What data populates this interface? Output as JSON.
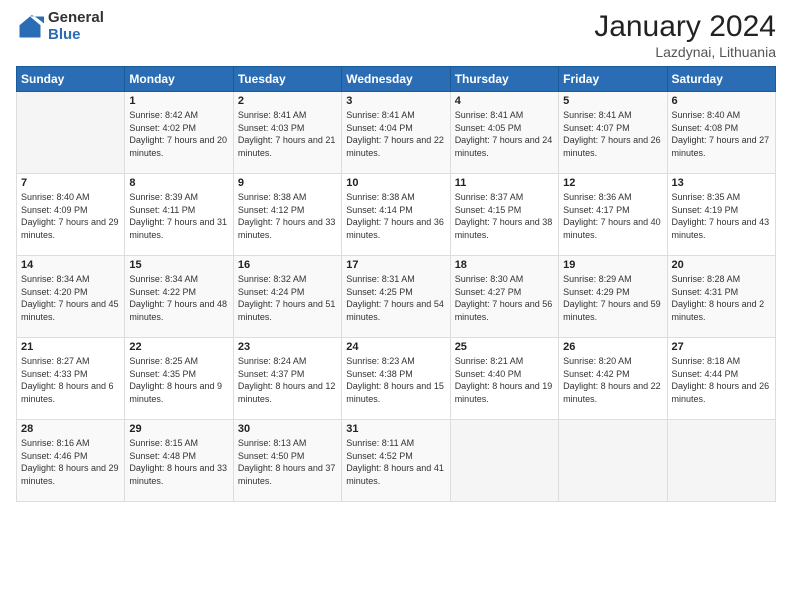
{
  "header": {
    "logo_general": "General",
    "logo_blue": "Blue",
    "title": "January 2024",
    "subtitle": "Lazdynai, Lithuania"
  },
  "days_of_week": [
    "Sunday",
    "Monday",
    "Tuesday",
    "Wednesday",
    "Thursday",
    "Friday",
    "Saturday"
  ],
  "weeks": [
    [
      {
        "day": "",
        "sunrise": "",
        "sunset": "",
        "daylight": ""
      },
      {
        "day": "1",
        "sunrise": "Sunrise: 8:42 AM",
        "sunset": "Sunset: 4:02 PM",
        "daylight": "Daylight: 7 hours and 20 minutes."
      },
      {
        "day": "2",
        "sunrise": "Sunrise: 8:41 AM",
        "sunset": "Sunset: 4:03 PM",
        "daylight": "Daylight: 7 hours and 21 minutes."
      },
      {
        "day": "3",
        "sunrise": "Sunrise: 8:41 AM",
        "sunset": "Sunset: 4:04 PM",
        "daylight": "Daylight: 7 hours and 22 minutes."
      },
      {
        "day": "4",
        "sunrise": "Sunrise: 8:41 AM",
        "sunset": "Sunset: 4:05 PM",
        "daylight": "Daylight: 7 hours and 24 minutes."
      },
      {
        "day": "5",
        "sunrise": "Sunrise: 8:41 AM",
        "sunset": "Sunset: 4:07 PM",
        "daylight": "Daylight: 7 hours and 26 minutes."
      },
      {
        "day": "6",
        "sunrise": "Sunrise: 8:40 AM",
        "sunset": "Sunset: 4:08 PM",
        "daylight": "Daylight: 7 hours and 27 minutes."
      }
    ],
    [
      {
        "day": "7",
        "sunrise": "Sunrise: 8:40 AM",
        "sunset": "Sunset: 4:09 PM",
        "daylight": "Daylight: 7 hours and 29 minutes."
      },
      {
        "day": "8",
        "sunrise": "Sunrise: 8:39 AM",
        "sunset": "Sunset: 4:11 PM",
        "daylight": "Daylight: 7 hours and 31 minutes."
      },
      {
        "day": "9",
        "sunrise": "Sunrise: 8:38 AM",
        "sunset": "Sunset: 4:12 PM",
        "daylight": "Daylight: 7 hours and 33 minutes."
      },
      {
        "day": "10",
        "sunrise": "Sunrise: 8:38 AM",
        "sunset": "Sunset: 4:14 PM",
        "daylight": "Daylight: 7 hours and 36 minutes."
      },
      {
        "day": "11",
        "sunrise": "Sunrise: 8:37 AM",
        "sunset": "Sunset: 4:15 PM",
        "daylight": "Daylight: 7 hours and 38 minutes."
      },
      {
        "day": "12",
        "sunrise": "Sunrise: 8:36 AM",
        "sunset": "Sunset: 4:17 PM",
        "daylight": "Daylight: 7 hours and 40 minutes."
      },
      {
        "day": "13",
        "sunrise": "Sunrise: 8:35 AM",
        "sunset": "Sunset: 4:19 PM",
        "daylight": "Daylight: 7 hours and 43 minutes."
      }
    ],
    [
      {
        "day": "14",
        "sunrise": "Sunrise: 8:34 AM",
        "sunset": "Sunset: 4:20 PM",
        "daylight": "Daylight: 7 hours and 45 minutes."
      },
      {
        "day": "15",
        "sunrise": "Sunrise: 8:34 AM",
        "sunset": "Sunset: 4:22 PM",
        "daylight": "Daylight: 7 hours and 48 minutes."
      },
      {
        "day": "16",
        "sunrise": "Sunrise: 8:32 AM",
        "sunset": "Sunset: 4:24 PM",
        "daylight": "Daylight: 7 hours and 51 minutes."
      },
      {
        "day": "17",
        "sunrise": "Sunrise: 8:31 AM",
        "sunset": "Sunset: 4:25 PM",
        "daylight": "Daylight: 7 hours and 54 minutes."
      },
      {
        "day": "18",
        "sunrise": "Sunrise: 8:30 AM",
        "sunset": "Sunset: 4:27 PM",
        "daylight": "Daylight: 7 hours and 56 minutes."
      },
      {
        "day": "19",
        "sunrise": "Sunrise: 8:29 AM",
        "sunset": "Sunset: 4:29 PM",
        "daylight": "Daylight: 7 hours and 59 minutes."
      },
      {
        "day": "20",
        "sunrise": "Sunrise: 8:28 AM",
        "sunset": "Sunset: 4:31 PM",
        "daylight": "Daylight: 8 hours and 2 minutes."
      }
    ],
    [
      {
        "day": "21",
        "sunrise": "Sunrise: 8:27 AM",
        "sunset": "Sunset: 4:33 PM",
        "daylight": "Daylight: 8 hours and 6 minutes."
      },
      {
        "day": "22",
        "sunrise": "Sunrise: 8:25 AM",
        "sunset": "Sunset: 4:35 PM",
        "daylight": "Daylight: 8 hours and 9 minutes."
      },
      {
        "day": "23",
        "sunrise": "Sunrise: 8:24 AM",
        "sunset": "Sunset: 4:37 PM",
        "daylight": "Daylight: 8 hours and 12 minutes."
      },
      {
        "day": "24",
        "sunrise": "Sunrise: 8:23 AM",
        "sunset": "Sunset: 4:38 PM",
        "daylight": "Daylight: 8 hours and 15 minutes."
      },
      {
        "day": "25",
        "sunrise": "Sunrise: 8:21 AM",
        "sunset": "Sunset: 4:40 PM",
        "daylight": "Daylight: 8 hours and 19 minutes."
      },
      {
        "day": "26",
        "sunrise": "Sunrise: 8:20 AM",
        "sunset": "Sunset: 4:42 PM",
        "daylight": "Daylight: 8 hours and 22 minutes."
      },
      {
        "day": "27",
        "sunrise": "Sunrise: 8:18 AM",
        "sunset": "Sunset: 4:44 PM",
        "daylight": "Daylight: 8 hours and 26 minutes."
      }
    ],
    [
      {
        "day": "28",
        "sunrise": "Sunrise: 8:16 AM",
        "sunset": "Sunset: 4:46 PM",
        "daylight": "Daylight: 8 hours and 29 minutes."
      },
      {
        "day": "29",
        "sunrise": "Sunrise: 8:15 AM",
        "sunset": "Sunset: 4:48 PM",
        "daylight": "Daylight: 8 hours and 33 minutes."
      },
      {
        "day": "30",
        "sunrise": "Sunrise: 8:13 AM",
        "sunset": "Sunset: 4:50 PM",
        "daylight": "Daylight: 8 hours and 37 minutes."
      },
      {
        "day": "31",
        "sunrise": "Sunrise: 8:11 AM",
        "sunset": "Sunset: 4:52 PM",
        "daylight": "Daylight: 8 hours and 41 minutes."
      },
      {
        "day": "",
        "sunrise": "",
        "sunset": "",
        "daylight": ""
      },
      {
        "day": "",
        "sunrise": "",
        "sunset": "",
        "daylight": ""
      },
      {
        "day": "",
        "sunrise": "",
        "sunset": "",
        "daylight": ""
      }
    ]
  ]
}
